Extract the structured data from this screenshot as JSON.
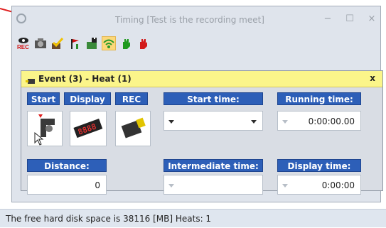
{
  "window": {
    "title": "Timing [Test is the recording meet]",
    "controls": {
      "minimize": "−",
      "maximize": "☐",
      "close": "×"
    }
  },
  "toolbar": {
    "icons": [
      {
        "name": "eye-rec-icon",
        "label": "REC",
        "selected": false
      },
      {
        "name": "camera-icon",
        "selected": false
      },
      {
        "name": "checked-tool-icon",
        "selected": false
      },
      {
        "name": "flag-i-icon",
        "selected": false
      },
      {
        "name": "checker-flag-icon",
        "selected": false
      },
      {
        "name": "wifi-signal-icon",
        "selected": true
      },
      {
        "name": "green-hand-icon",
        "selected": false
      },
      {
        "name": "red-hand-icon",
        "selected": false
      }
    ]
  },
  "panel": {
    "title": "Event (3) - Heat (1)",
    "close": "x",
    "buttons": {
      "start": "Start",
      "display": "Display",
      "rec": "REC"
    },
    "labels": {
      "start_time": "Start time:",
      "running_time": "Running time:",
      "distance": "Distance:",
      "intermediate_time": "Intermediate time:",
      "display_time": "Display time:"
    },
    "values": {
      "start_time": "",
      "running_time": "0:00:00.00",
      "distance": "0",
      "intermediate_time": "",
      "display_time": "0:00:00"
    },
    "display_digits": "8888"
  },
  "status": {
    "text": "The free hard disk space is 38116 [MB]  Heats: 1"
  },
  "colors": {
    "accent_blue": "#2d5fb8",
    "header_yellow": "#fbf58a",
    "selected_orange": "#fcd87a",
    "arrow_red": "#e02020"
  }
}
